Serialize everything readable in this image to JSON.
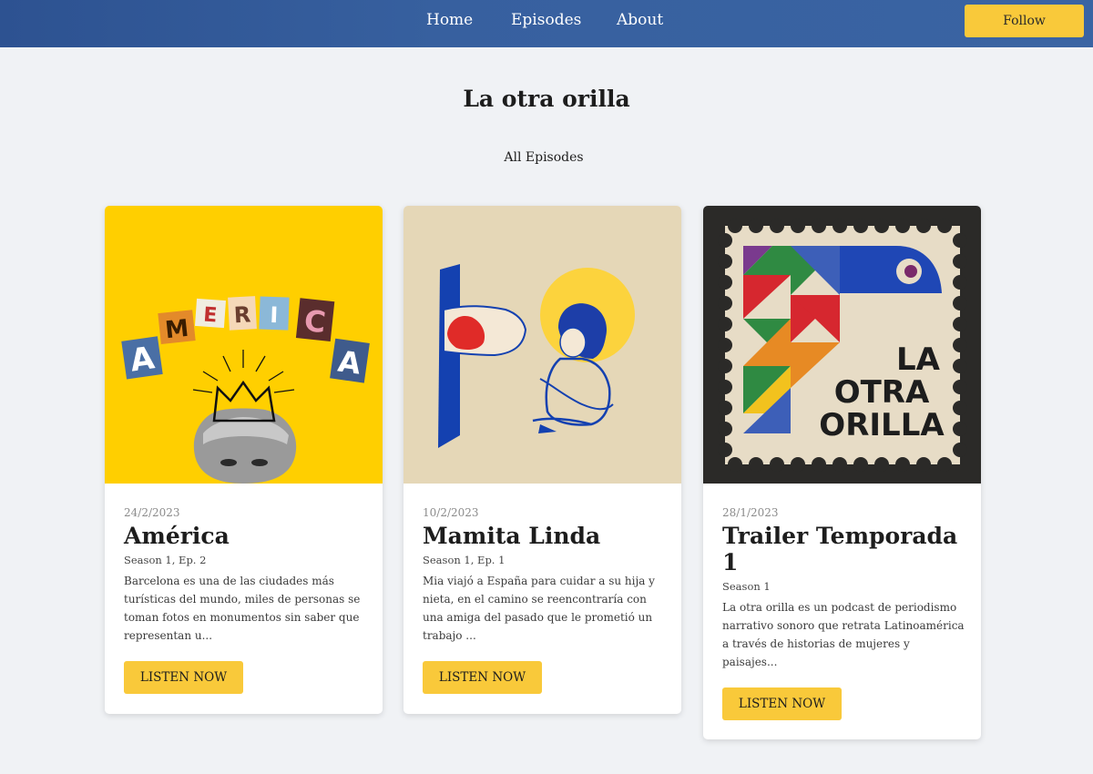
{
  "nav": {
    "home": "Home",
    "episodes": "Episodes",
    "about": "About",
    "follow": "Follow"
  },
  "page": {
    "title": "La otra orilla",
    "subtitle": "All Episodes"
  },
  "episodes": [
    {
      "date": "24/2/2023",
      "title": "América",
      "season": "Season 1, Ep. 2",
      "description": "Barcelona es una de las ciudades más turísticas del mundo, miles de personas se toman fotos en monumentos sin saber que representan u...",
      "button": "LISTEN NOW",
      "art_text": [
        "A",
        "M",
        "E",
        "R",
        "I",
        "C",
        "A"
      ]
    },
    {
      "date": "10/2/2023",
      "title": "Mamita Linda",
      "season": "Season 1, Ep. 1",
      "description": "Mia viajó a España para cuidar a su hija y nieta, en el camino se reencontraría con una amiga del pasado que le prometió un trabajo ...",
      "button": "LISTEN NOW"
    },
    {
      "date": "28/1/2023",
      "title": "Trailer Temporada 1",
      "season": "Season 1",
      "description": "La otra orilla es un podcast de periodismo narrativo sonoro que retrata Latinoamérica a través de historias de mujeres y paisajes...",
      "button": "LISTEN NOW",
      "art_text": [
        "LA",
        "OTRA",
        "ORILLA"
      ]
    }
  ],
  "colors": {
    "nav_bg": "#3a64a3",
    "accent": "#f9c93a",
    "background": "#f0f2f5"
  }
}
